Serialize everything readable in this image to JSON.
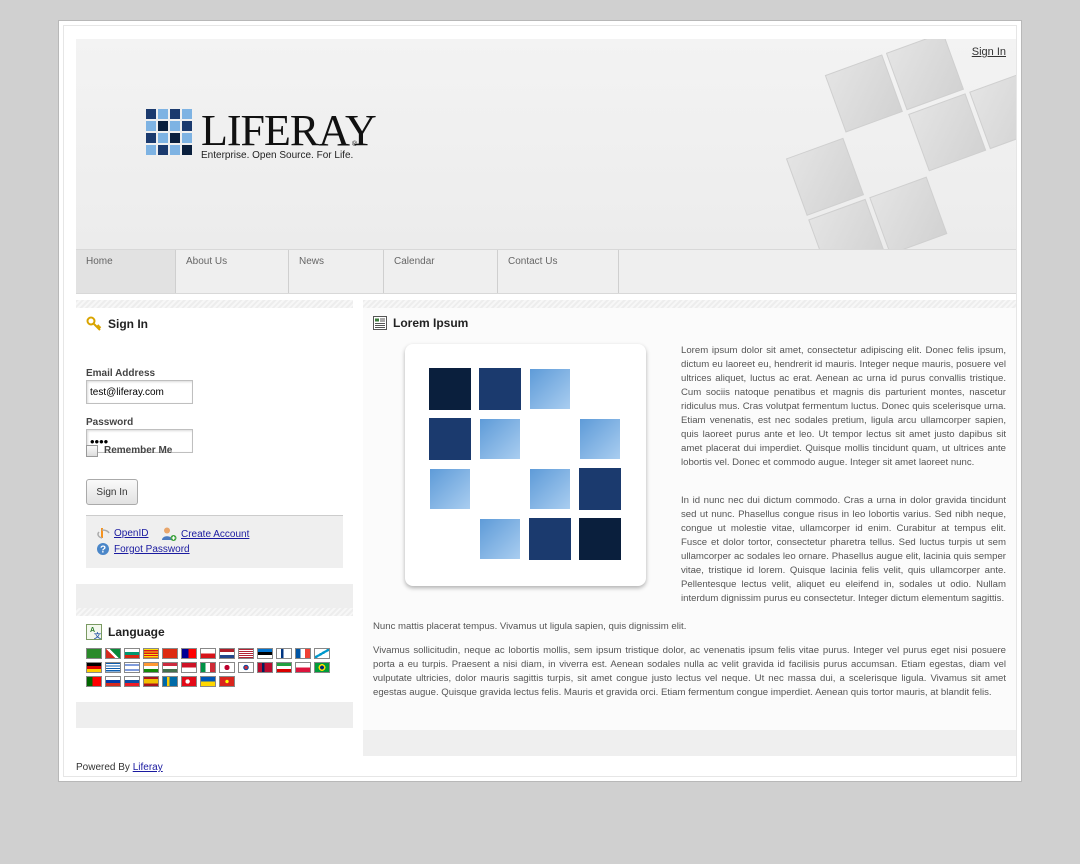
{
  "header": {
    "sign_in_link": "Sign In",
    "logo_word": "LIFERAY",
    "logo_reg": "®",
    "logo_tagline": "Enterprise. Open Source. For Life."
  },
  "nav": {
    "items": [
      {
        "label": "Home"
      },
      {
        "label": "About Us"
      },
      {
        "label": "News"
      },
      {
        "label": "Calendar"
      },
      {
        "label": "Contact Us"
      }
    ]
  },
  "signin_portlet": {
    "title": "Sign In",
    "title_icon": "key-icon",
    "email_label": "Email Address",
    "email_value": "test@liferay.com",
    "password_label": "Password",
    "password_value": "••••",
    "remember_label": "Remember Me",
    "submit_label": "Sign In",
    "links": {
      "openid": "OpenID",
      "create_account": "Create Account",
      "forgot_password": "Forgot Password"
    }
  },
  "language_portlet": {
    "title": "Language",
    "title_icon": "globe-language-icon",
    "flag_count": 32
  },
  "lorem_portlet": {
    "title": "Lorem Ipsum",
    "title_icon": "document-icon",
    "paragraph1": "Lorem ipsum dolor sit amet, consectetur adipiscing elit. Donec felis ipsum, dictum eu laoreet eu, hendrerit id mauris. Integer neque mauris, posuere vel ultrices aliquet, luctus ac erat. Aenean ac urna id purus convallis tristique. Cum sociis natoque penatibus et magnis dis parturient montes, nascetur ridiculus mus. Cras volutpat fermentum luctus. Donec quis scelerisque urna. Etiam venenatis, est nec sodales pretium, ligula arcu ullamcorper sapien, quis laoreet purus ante et leo. Ut tempor lectus sit amet justo dapibus sit amet placerat dui imperdiet. Quisque mollis tincidunt quam, ut ultrices ante lobortis vel. Donec et commodo augue. Integer sit amet laoreet nunc.",
    "paragraph2a": "In id nunc nec dui dictum commodo. Cras a urna in dolor gravida tincidunt sed ut nunc. Phasellus congue risus in leo lobortis varius. Sed nibh neque, congue ut molestie vitae, ullamcorper id enim. Curabitur at tempus elit. Fusce et dolor tortor, consectetur pharetra tellus. Sed luctus turpis ut sem ullamcorper ac sodales leo ornare. Phasellus augue elit, lacinia quis semper vitae, tristique id lorem. Quisque lacinia felis velit, quis ullamcorper ante. Pellentesque lectus velit, aliquet eu eleifend in, sodales ut odio. Nullam interdum dignissim purus eu consectetur. Integer dictum elementum sagittis.",
    "paragraph2b": "Nunc mattis placerat tempus. Vivamus ut ligula sapien, quis dignissim elit.",
    "paragraph3": "Vivamus sollicitudin, neque ac lobortis mollis, sem ipsum tristique dolor, ac venenatis ipsum felis vitae purus. Integer vel purus eget nisi posuere porta a eu turpis. Praesent a nisi diam, in viverra est. Aenean sodales nulla ac velit gravida id facilisis purus accumsan. Etiam egestas, diam vel vulputate ultricies, dolor mauris sagittis turpis, sit amet congue justo lectus vel neque. Ut nec massa dui, a scelerisque ligula. Vivamus sit amet egestas augue. Quisque gravida lectus felis. Mauris et gravida orci. Etiam fermentum congue imperdiet. Aenean quis tortor mauris, at blandit felis."
  },
  "footer": {
    "powered_by": "Powered By",
    "powered_link": "Liferay"
  },
  "colors": {
    "dark_navy": "#0a1f3d",
    "navy": "#1b3a6e",
    "light_blue": "#7eb3e3",
    "link": "#1a1aa0"
  }
}
